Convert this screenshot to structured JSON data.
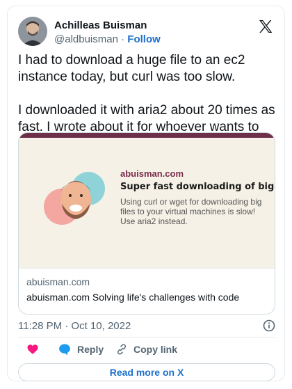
{
  "author": {
    "name": "Achilleas Buisman",
    "handle": "@aldbuisman",
    "separator": " · ",
    "follow_label": "Follow"
  },
  "tweet": {
    "text": "I had to download a huge file to an ec2 instance today, but curl was too slow.\n\nI downloaded it with aria2 about 20 times as fast. I wrote about it for whoever wants to see:"
  },
  "link_card": {
    "preview_site": "abuisman.com",
    "preview_headline": "Super fast downloading of big files",
    "preview_description": "Using curl or wget for downloading big files to your virtual machines is slow! Use aria2 instead.",
    "domain": "abuisman.com",
    "title": "abuisman.com Solving life's challenges with code"
  },
  "timestamp": "11:28 PM · Oct 10, 2022",
  "actions": {
    "reply_label": "Reply",
    "copy_label": "Copy link"
  },
  "read_more_label": "Read more on X",
  "colors": {
    "accent": "#1d6fcc",
    "like": "#f91880",
    "reply": "#1d9bf0",
    "card_band": "#6d2f4a",
    "card_bg": "#f5f1e6"
  },
  "icons": [
    "x-logo-icon",
    "heart-icon",
    "reply-bubble-icon",
    "link-icon",
    "info-icon"
  ]
}
